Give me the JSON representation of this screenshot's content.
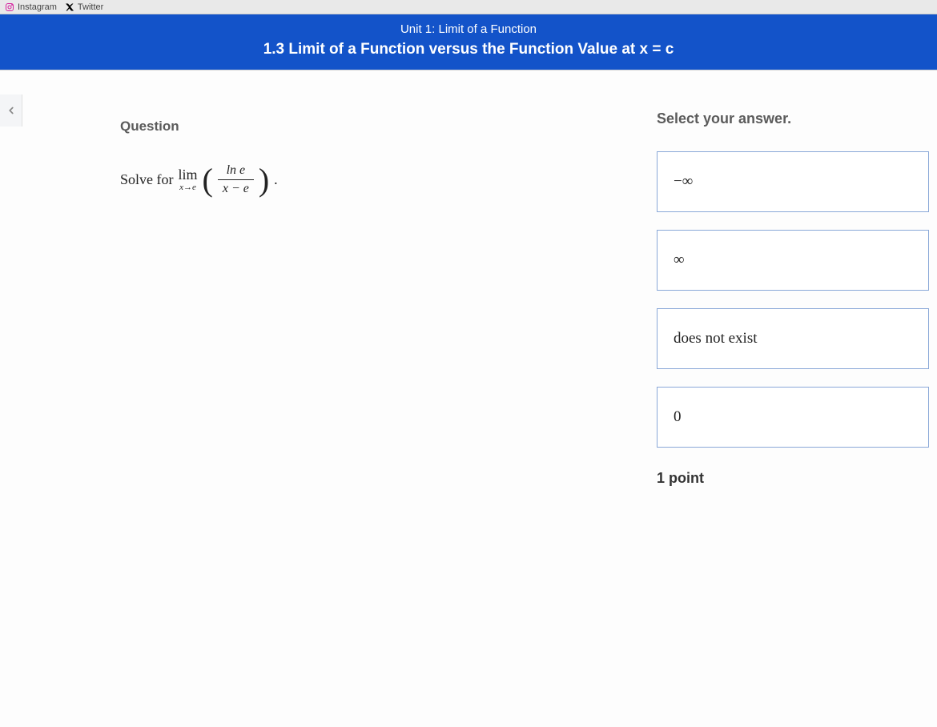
{
  "bookmarks": {
    "instagram": "Instagram",
    "twitter": "Twitter"
  },
  "header": {
    "unit": "Unit 1: Limit of a Function",
    "section": "1.3 Limit of a Function versus the Function Value at x = c"
  },
  "question": {
    "label": "Question",
    "prefix": "Solve for",
    "lim_top": "lim",
    "lim_sub": "x→e",
    "frac_num": "ln e",
    "frac_den": "x − e",
    "suffix": "."
  },
  "answers": {
    "prompt": "Select your answer.",
    "options": [
      "−∞",
      "∞",
      "does not exist",
      "0"
    ],
    "points": "1 point"
  }
}
